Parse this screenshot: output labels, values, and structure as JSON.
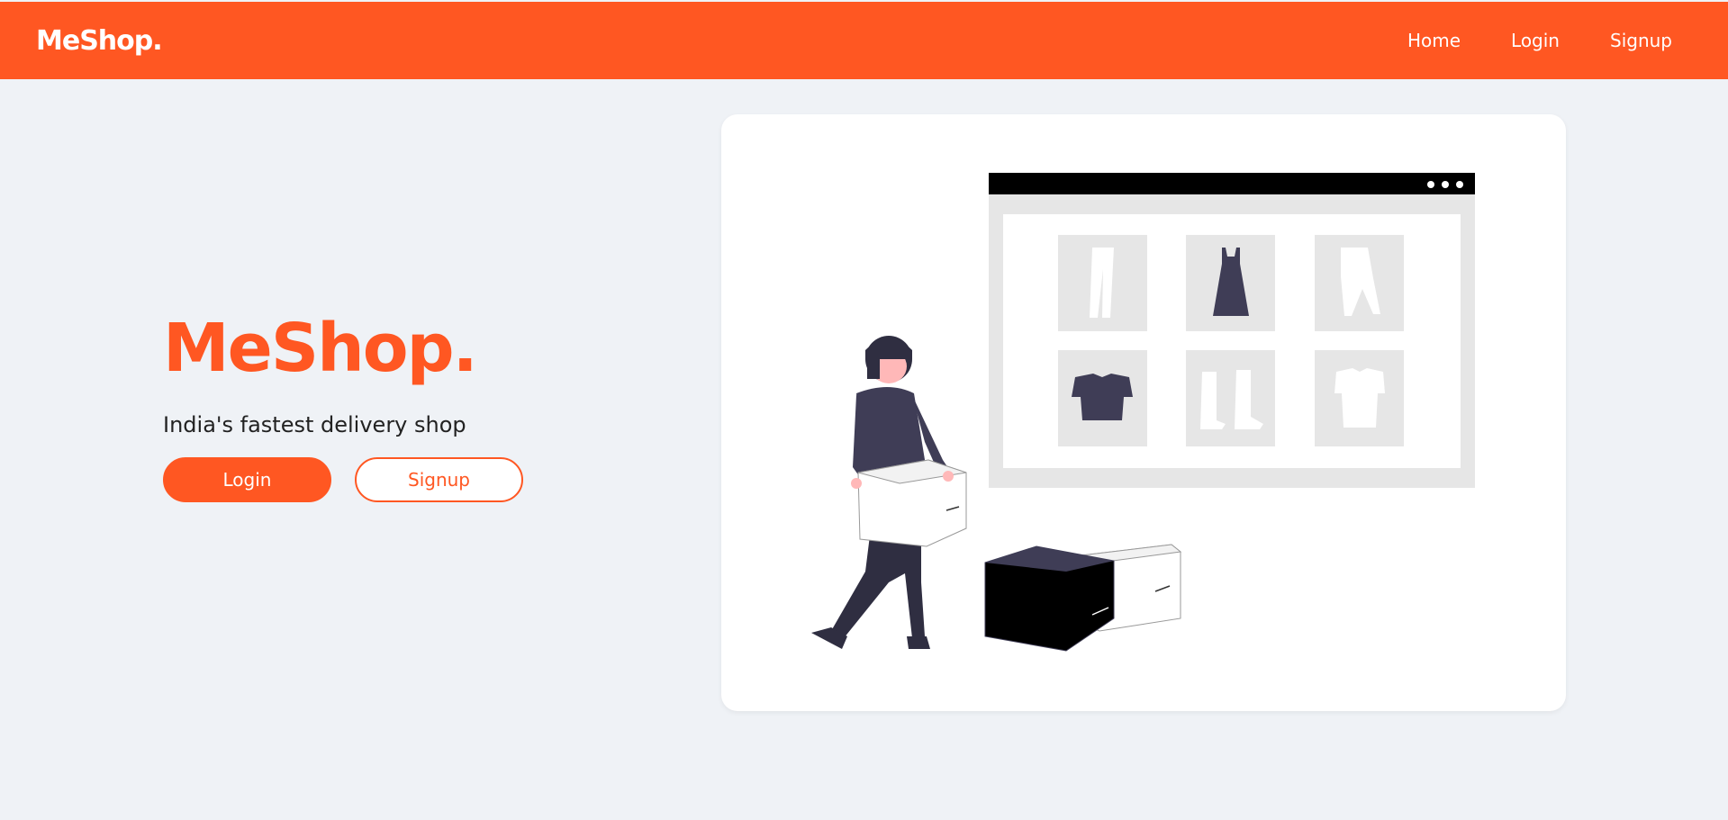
{
  "header": {
    "brand": "MeShop.",
    "nav": [
      {
        "label": "Home"
      },
      {
        "label": "Login"
      },
      {
        "label": "Signup"
      }
    ]
  },
  "hero": {
    "title": "MeShop.",
    "subtitle": "India's fastest delivery shop",
    "login_label": "Login",
    "signup_label": "Signup"
  },
  "colors": {
    "brand": "#ff5722",
    "background": "#eff2f6"
  }
}
